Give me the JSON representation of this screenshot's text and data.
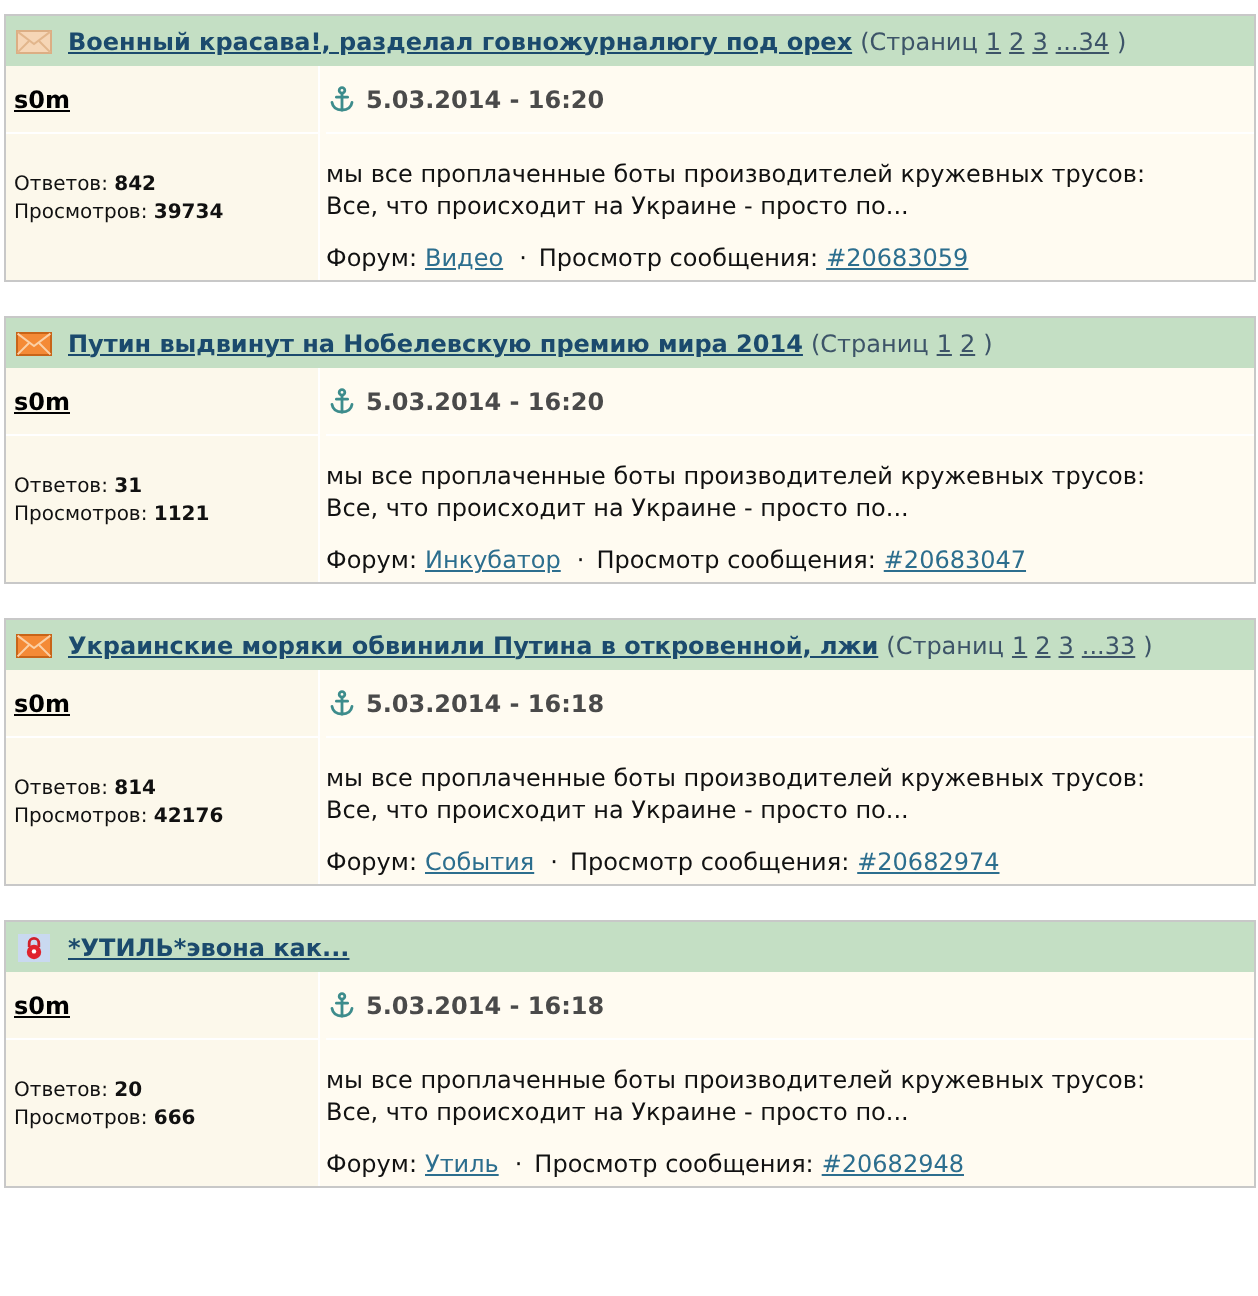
{
  "topics": [
    {
      "kind": "read",
      "title": "Военный красава!, разделал говножурналюгу под орех",
      "pages_open": "(Страниц",
      "pages": [
        "1",
        "2",
        "3",
        "...34"
      ],
      "pages_close": ")",
      "author": "s0m",
      "date": "5.03.2014 - 16:20",
      "replies": "Ответов: **842**",
      "views": "Просмотров: **39734**",
      "excerpt": "мы все проплаченные боты производителей кружевных трусов:\nВсе, что происходит на Украине - просто по...",
      "forum_label": "Форум:",
      "forum": "Видео",
      "separator": "·",
      "post_label": "Просмотр сообщения:",
      "post_link": "#20683059"
    },
    {
      "kind": "new",
      "title": "Путин выдвинут на Нобелевскую премию мира 2014",
      "pages_open": "(Страниц",
      "pages": [
        "1",
        "2"
      ],
      "pages_close": ")",
      "author": "s0m",
      "date": "5.03.2014 - 16:20",
      "replies": "Ответов: **31**",
      "views": "Просмотров: **1121**",
      "excerpt": "мы все проплаченные боты производителей кружевных трусов:\nВсе, что происходит на Украине - просто по...",
      "forum_label": "Форум:",
      "forum": "Инкубатор",
      "separator": "·",
      "post_label": "Просмотр сообщения:",
      "post_link": "#20683047"
    },
    {
      "kind": "new",
      "title": "Украинские моряки обвинили Путина в откровенной, лжи",
      "pages_open": "(Страниц",
      "pages": [
        "1",
        "2",
        "3",
        "...33"
      ],
      "pages_close": ")",
      "author": "s0m",
      "date": "5.03.2014 - 16:18",
      "replies": "Ответов: **814**",
      "views": "Просмотров: **42176**",
      "excerpt": "мы все проплаченные боты производителей кружевных трусов:\nВсе, что происходит на Украине - просто по...",
      "forum_label": "Форум:",
      "forum": "События",
      "separator": "·",
      "post_label": "Просмотр сообщения:",
      "post_link": "#20682974"
    },
    {
      "kind": "closed",
      "title": "*УТИЛЬ*эвона как...",
      "author": "s0m",
      "date": "5.03.2014 - 16:18",
      "replies": "Ответов: **20**",
      "views": "Просмотров: **666**",
      "excerpt": "мы все проплаченные боты производителей кружевных трусов:\nВсе, что происходит на Украине - просто по...",
      "forum_label": "Форум:",
      "forum": "Утиль",
      "separator": "·",
      "post_label": "Просмотр сообщения:",
      "post_link": "#20682948"
    }
  ]
}
